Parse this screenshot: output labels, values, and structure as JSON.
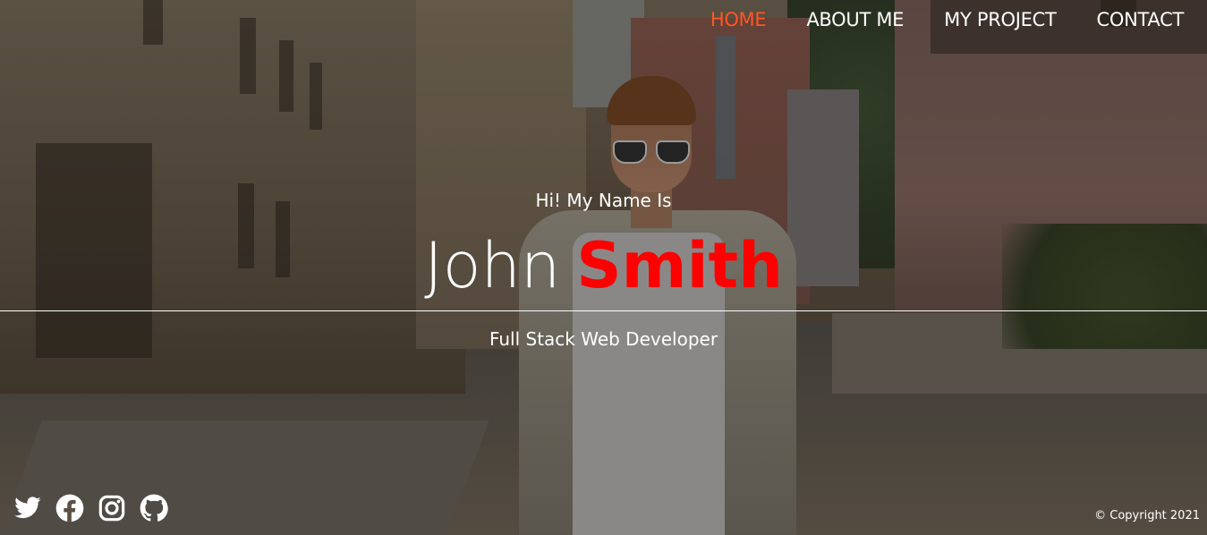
{
  "nav": {
    "items": [
      {
        "label": "HOME",
        "active": true
      },
      {
        "label": "ABOUT ME",
        "active": false
      },
      {
        "label": "MY PROJECT",
        "active": false
      },
      {
        "label": "CONTACT",
        "active": false
      }
    ],
    "active_color": "#ff5722"
  },
  "hero": {
    "greeting": "Hi! My Name Is",
    "first_name": "John",
    "last_name": "Smith",
    "last_name_color": "#ff0000",
    "role": "Full Stack Web Developer"
  },
  "socials": [
    {
      "icon": "twitter-icon"
    },
    {
      "icon": "facebook-icon"
    },
    {
      "icon": "instagram-icon"
    },
    {
      "icon": "github-icon"
    }
  ],
  "footer": {
    "copyright": "© Copyright 2021"
  }
}
